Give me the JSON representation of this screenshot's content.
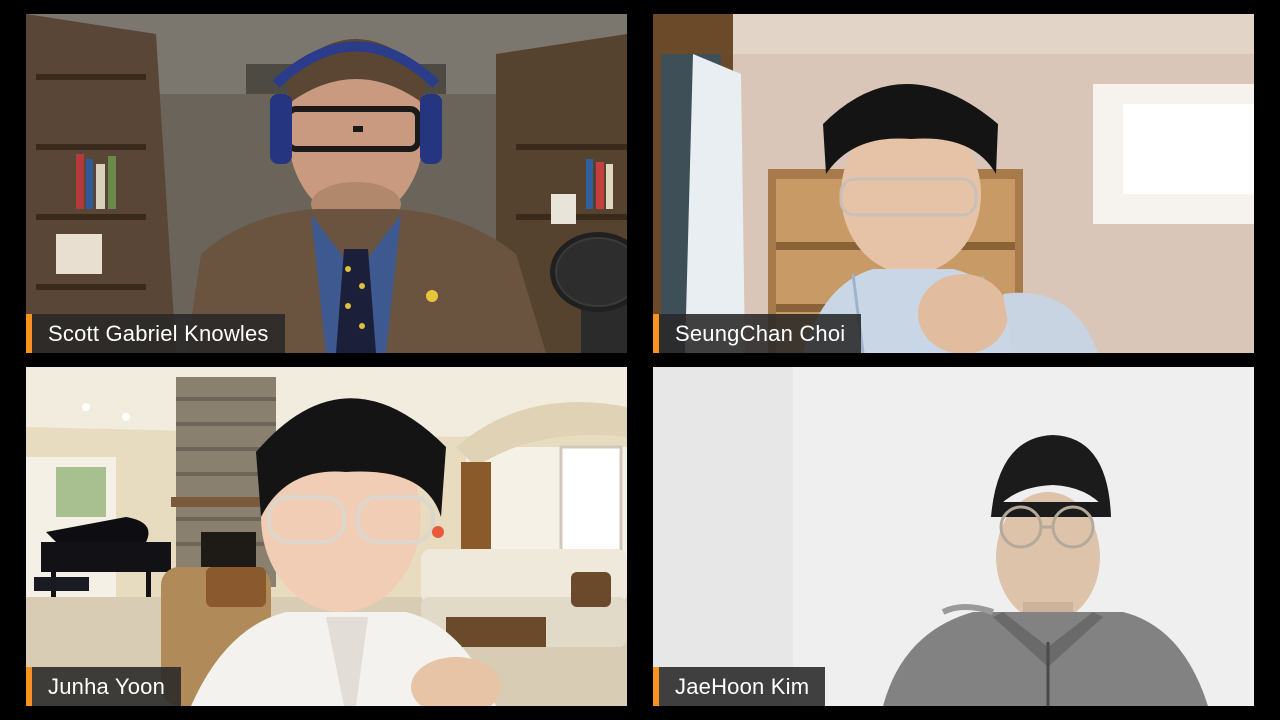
{
  "call": {
    "layout": "2x2 grid",
    "accent_color": "#f7931e",
    "participants": [
      {
        "name": "Scott Gabriel Knowles",
        "background": "home library with bookshelves",
        "has_microphone": true
      },
      {
        "name": "SeungChan Choi",
        "background": "room with wooden shelf and window"
      },
      {
        "name": "Junha Yoon",
        "background": "living room with grand piano and stone fireplace"
      },
      {
        "name": "JaeHoon Kim",
        "background": "plain white wall"
      }
    ]
  }
}
